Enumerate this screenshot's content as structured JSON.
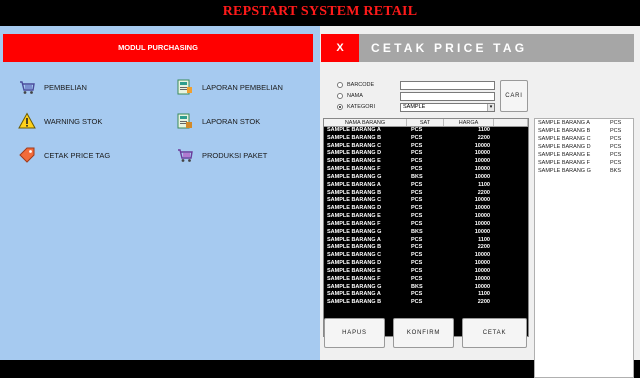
{
  "app": {
    "title": "REPSTART SYSTEM RETAIL"
  },
  "left_panel": {
    "module_title": "MODUL PURCHASING",
    "menu": [
      {
        "label": "PEMBELIAN",
        "icon": "cart-icon"
      },
      {
        "label": "LAPORAN PEMBELIAN",
        "icon": "report-icon"
      },
      {
        "label": "WARNING STOK",
        "icon": "warning-icon"
      },
      {
        "label": "LAPORAN STOK",
        "icon": "stock-report-icon"
      },
      {
        "label": "CETAK PRICE TAG",
        "icon": "price-tag-icon"
      },
      {
        "label": "PRODUKSI PAKET",
        "icon": "package-cart-icon"
      }
    ]
  },
  "right_panel": {
    "close_label": "X",
    "title": "CETAK PRICE TAG",
    "search": {
      "options": [
        {
          "label": "BARCODE",
          "selected": false
        },
        {
          "label": "NAMA",
          "selected": false
        },
        {
          "label": "KATEGORI",
          "selected": true
        }
      ],
      "barcode_value": "",
      "nama_value": "",
      "kategori_value": "SAMPLE",
      "search_button": "CARI"
    },
    "grid": {
      "columns": [
        "NAMA BARANG",
        "SAT",
        "HARGA"
      ],
      "rows": [
        [
          "SAMPLE BARANG A",
          "PCS",
          "1100"
        ],
        [
          "SAMPLE BARANG B",
          "PCS",
          "2200"
        ],
        [
          "SAMPLE BARANG C",
          "PCS",
          "10000"
        ],
        [
          "SAMPLE BARANG D",
          "PCS",
          "10000"
        ],
        [
          "SAMPLE BARANG E",
          "PCS",
          "10000"
        ],
        [
          "SAMPLE BARANG F",
          "PCS",
          "10000"
        ],
        [
          "SAMPLE BARANG G",
          "BKS",
          "10000"
        ],
        [
          "SAMPLE BARANG A",
          "PCS",
          "1100"
        ],
        [
          "SAMPLE BARANG B",
          "PCS",
          "2200"
        ],
        [
          "SAMPLE BARANG C",
          "PCS",
          "10000"
        ],
        [
          "SAMPLE BARANG D",
          "PCS",
          "10000"
        ],
        [
          "SAMPLE BARANG E",
          "PCS",
          "10000"
        ],
        [
          "SAMPLE BARANG F",
          "PCS",
          "10000"
        ],
        [
          "SAMPLE BARANG G",
          "BKS",
          "10000"
        ],
        [
          "SAMPLE BARANG A",
          "PCS",
          "1100"
        ],
        [
          "SAMPLE BARANG B",
          "PCS",
          "2200"
        ],
        [
          "SAMPLE BARANG C",
          "PCS",
          "10000"
        ],
        [
          "SAMPLE BARANG D",
          "PCS",
          "10000"
        ],
        [
          "SAMPLE BARANG E",
          "PCS",
          "10000"
        ],
        [
          "SAMPLE BARANG F",
          "PCS",
          "10000"
        ],
        [
          "SAMPLE BARANG G",
          "BKS",
          "10000"
        ],
        [
          "SAMPLE BARANG A",
          "PCS",
          "1100"
        ],
        [
          "SAMPLE BARANG B",
          "PCS",
          "2200"
        ]
      ]
    },
    "selected_list": [
      [
        "SAMPLE BARANG A",
        "PCS"
      ],
      [
        "SAMPLE BARANG B",
        "PCS"
      ],
      [
        "SAMPLE BARANG C",
        "PCS"
      ],
      [
        "SAMPLE BARANG D",
        "PCS"
      ],
      [
        "SAMPLE BARANG E",
        "PCS"
      ],
      [
        "SAMPLE BARANG F",
        "PCS"
      ],
      [
        "SAMPLE BARANG G",
        "BKS"
      ]
    ],
    "buttons": {
      "hapus": "HAPUS",
      "konfirm": "KONFIRM",
      "cetak": "CETAK"
    }
  },
  "colors": {
    "accent": "#ff0000",
    "title_text": "#ff1a1a",
    "left_bg": "#a6caf0",
    "header_band": "#a6a6a6"
  }
}
